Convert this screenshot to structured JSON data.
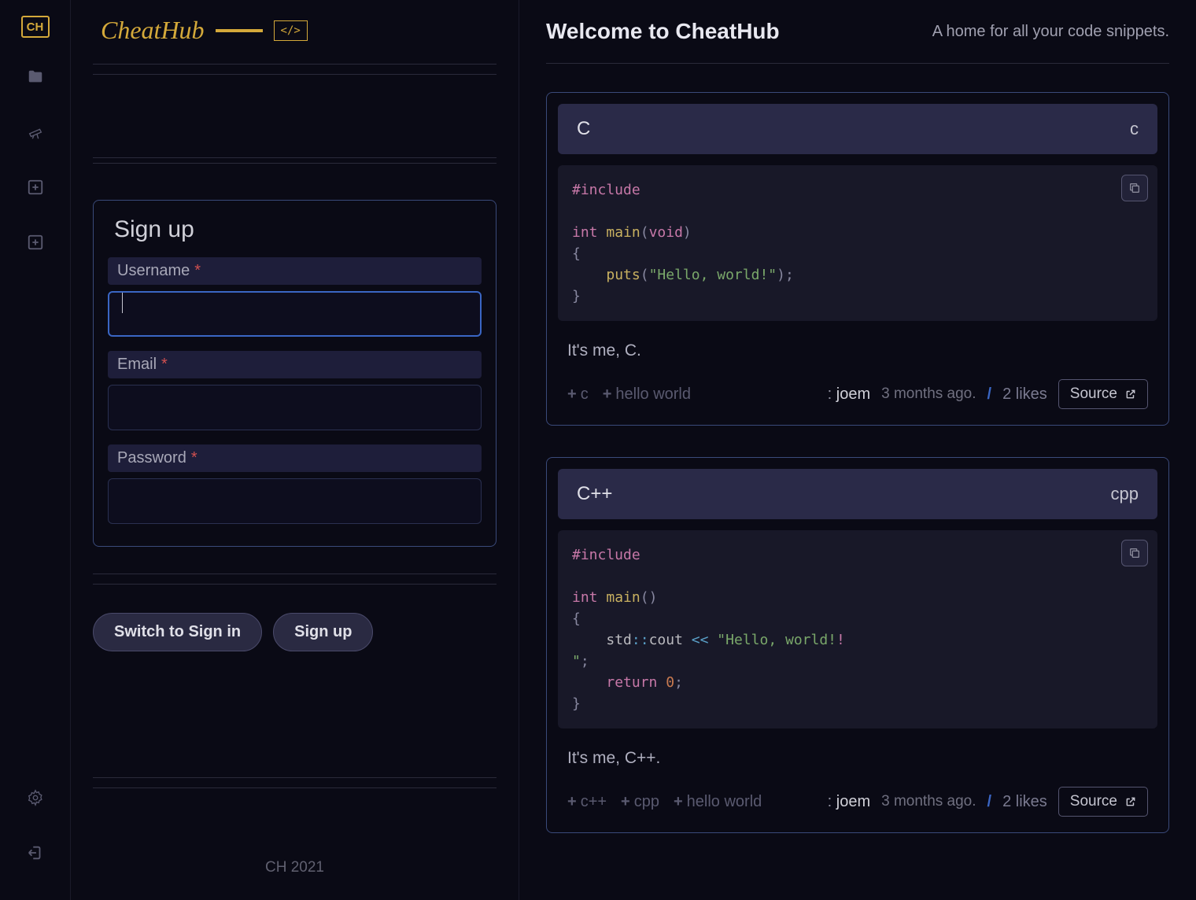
{
  "brand": {
    "name": "CheatHub",
    "code_glyph": "</>",
    "logo_short": "CH"
  },
  "signup": {
    "title": "Sign up",
    "username_label": "Username",
    "email_label": "Email",
    "password_label": "Password",
    "required_mark": "*",
    "switch_btn": "Switch to Sign in",
    "submit_btn": "Sign up"
  },
  "footer": "CH 2021",
  "main": {
    "title": "Welcome to CheatHub",
    "subtitle": "A home for all your code snippets."
  },
  "snippets": [
    {
      "title": "C",
      "lang": "c",
      "desc": "It's me, C.",
      "tags": [
        "c",
        "hello world"
      ],
      "author": "joem",
      "time": "3 months ago.",
      "likes": "2 likes",
      "source_label": "Source"
    },
    {
      "title": "C++",
      "lang": "cpp",
      "desc": "It's me, C++.",
      "tags": [
        "c++",
        "cpp",
        "hello world"
      ],
      "author": "joem",
      "time": "3 months ago.",
      "likes": "2 likes",
      "source_label": "Source"
    }
  ],
  "code_c": {
    "include": "#include",
    "int": "int",
    "main": "main",
    "void": "void",
    "puts": "puts",
    "str": "\"Hello, world!\"",
    "lparen": "(",
    "rparen": ")",
    "lbrace": "{",
    "rbrace": "}",
    "semi": ";"
  },
  "code_cpp": {
    "include": "#include",
    "int": "int",
    "main": "main",
    "std": "std",
    "dcolon": "::",
    "cout": "cout",
    "lshift": "<<",
    "str_part1": "\"Hello, world!",
    "str_part2": "\"",
    "return": "return",
    "zero": "0",
    "bang": "!",
    "lparen": "(",
    "rparen": ")",
    "lbrace": "{",
    "rbrace": "}",
    "semi": ";"
  }
}
